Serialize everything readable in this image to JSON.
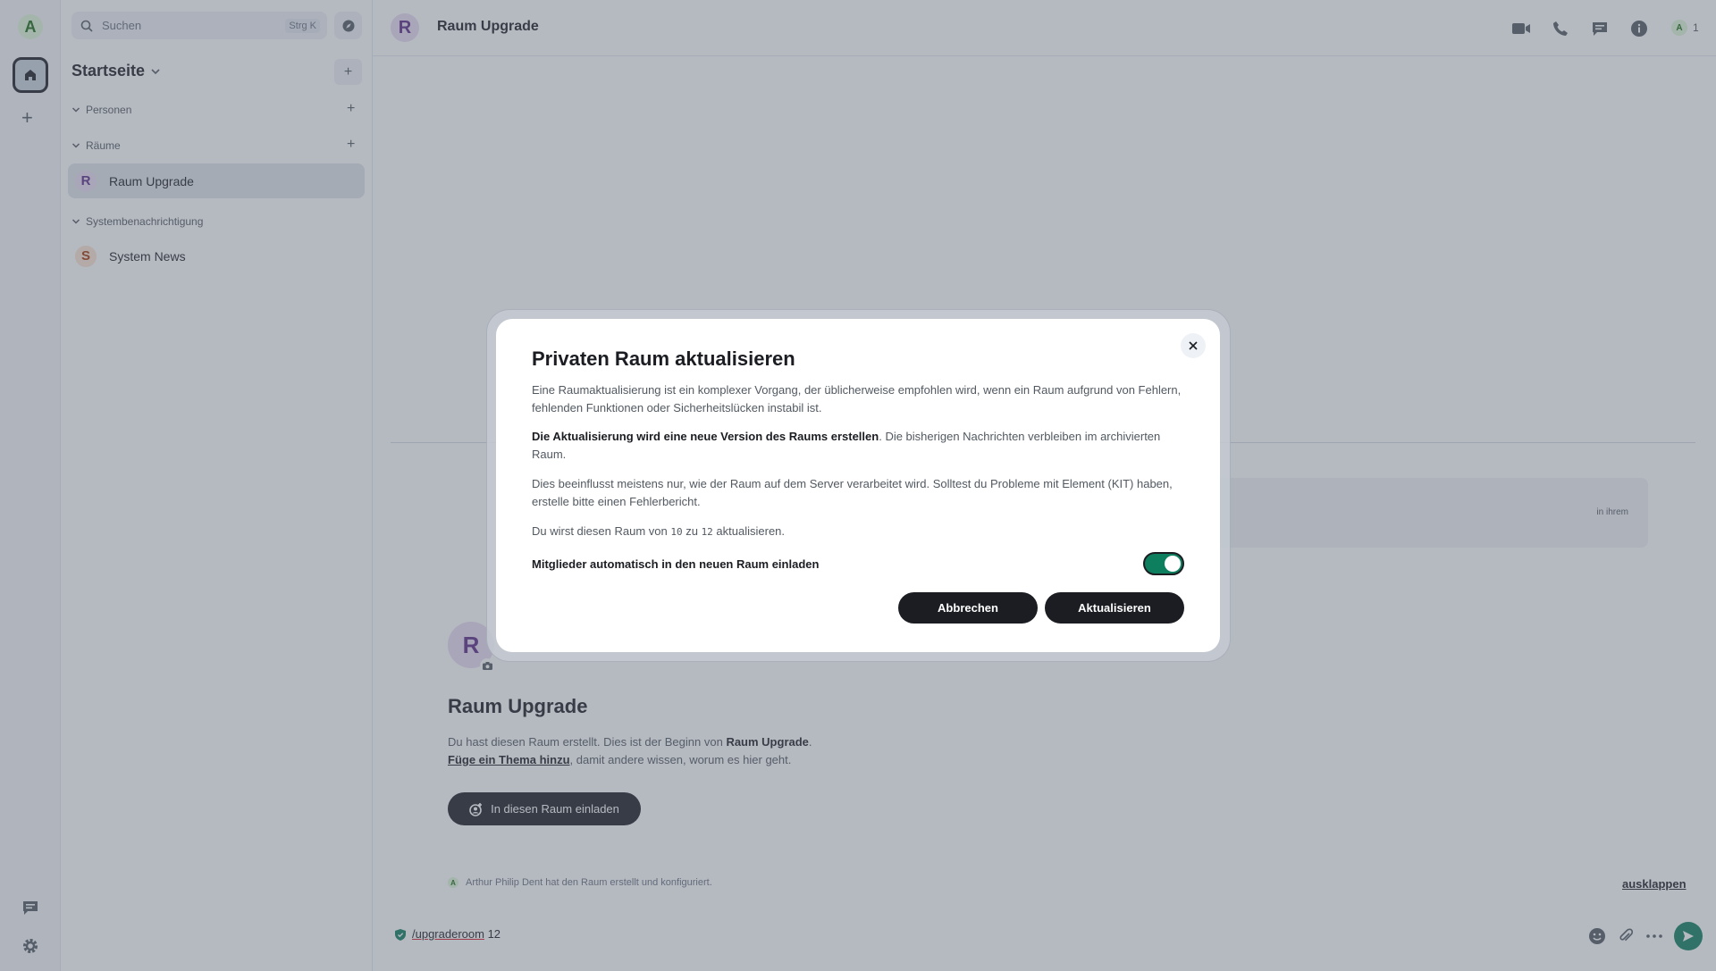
{
  "spacebar": {
    "user_initial": "A"
  },
  "roomlist": {
    "search_label": "Suchen",
    "search_shortcut": "Strg K",
    "home_title": "Startseite",
    "sections": [
      {
        "label": "Personen"
      },
      {
        "label": "Räume"
      },
      {
        "label": "Systembenachrichtigung"
      }
    ],
    "rooms": [
      {
        "initial": "R",
        "name": "Raum Upgrade"
      },
      {
        "initial": "S",
        "name": "System News"
      }
    ]
  },
  "header": {
    "room_initial": "R",
    "room_name": "Raum Upgrade",
    "member_initial": "A",
    "member_count": "1"
  },
  "timeline": {
    "ghost_text": "in ihrem",
    "room_initial": "R",
    "intro_title": "Raum Upgrade",
    "intro_line1_prefix": "Du hast diesen Raum erstellt. Dies ist der Beginn von ",
    "intro_line1_bold": "Raum Upgrade",
    "intro_line1_suffix": ".",
    "intro_link": "Füge ein Thema hinzu",
    "intro_line2_suffix": ", damit andere wissen, worum es hier geht.",
    "invite_label": "In diesen Raum einladen",
    "event_initial": "A",
    "event_text": "Arthur Philip Dent hat den Raum erstellt und konfiguriert.",
    "expand_label": "ausklappen"
  },
  "composer": {
    "command": "/upgraderoom",
    "argument": " 12"
  },
  "dialog": {
    "title": "Privaten Raum aktualisieren",
    "p1": "Eine Raumaktualisierung ist ein komplexer Vorgang, der üblicherweise empfohlen wird, wenn ein Raum aufgrund von Fehlern, fehlenden Funktionen oder Sicherheitslücken instabil ist.",
    "p2_bold": "Die Aktualisierung wird eine neue Version des Raums erstellen",
    "p2_rest": ". Die bisherigen Nachrichten verbleiben im archivierten Raum.",
    "p3": "Dies beeinflusst meistens nur, wie der Raum auf dem Server verarbeitet wird. Solltest du Probleme mit Element (KIT) haben, erstelle bitte einen Fehlerbericht.",
    "p4_prefix": "Du wirst diesen Raum von ",
    "p4_from": "10",
    "p4_mid": " zu ",
    "p4_to": "12",
    "p4_suffix": " aktualisieren.",
    "toggle_label": "Mitglieder automatisch in den neuen Raum einladen",
    "toggle_on": true,
    "cancel_label": "Abbrechen",
    "confirm_label": "Aktualisieren"
  },
  "colors": {
    "accent": "#0e7f5e",
    "room_avatar_bg": "#e9dcf5",
    "room_avatar_fg": "#5b2a86",
    "system_avatar_bg": "#fde3d3",
    "system_avatar_fg": "#a33a0b"
  }
}
